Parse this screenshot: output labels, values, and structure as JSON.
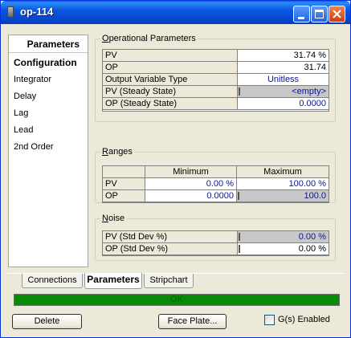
{
  "window": {
    "title": "op-114"
  },
  "nav": {
    "header": "Parameters",
    "items": [
      "Configuration",
      "Integrator",
      "Delay",
      "Lag",
      "Lead",
      "2nd Order"
    ],
    "active": "Configuration"
  },
  "operational": {
    "title_u": "O",
    "title_rest": "perational Parameters",
    "rows": [
      {
        "label": "PV",
        "value": "31.74 %"
      },
      {
        "label": "OP",
        "value": "31.74"
      },
      {
        "label": "Output Variable Type",
        "value": "Unitless"
      },
      {
        "label": "PV (Steady State)",
        "value": "<empty>"
      },
      {
        "label": "OP (Steady State)",
        "value": "0.0000"
      }
    ]
  },
  "ranges": {
    "title_u": "R",
    "title_rest": "anges",
    "headers": [
      "Minimum",
      "Maximum"
    ],
    "rows": [
      {
        "label": "PV",
        "min": "0.00 %",
        "max": "100.00 %"
      },
      {
        "label": "OP",
        "min": "0.0000",
        "max": "100.0"
      }
    ]
  },
  "noise": {
    "title_u": "N",
    "title_rest": "oise",
    "rows": [
      {
        "label": "PV (Std Dev %)",
        "value": "0.00 %"
      },
      {
        "label": "OP (Std Dev %)",
        "value": "0.00 %"
      }
    ]
  },
  "tabs": [
    "Connections",
    "Parameters",
    "Stripchart"
  ],
  "active_tab": "Parameters",
  "status": {
    "text": "OK",
    "color": "#098a08"
  },
  "buttons": {
    "delete": "Delete",
    "face_plate": "Face Plate..."
  },
  "checkbox": {
    "label": "G(s) Enabled",
    "checked": false
  }
}
